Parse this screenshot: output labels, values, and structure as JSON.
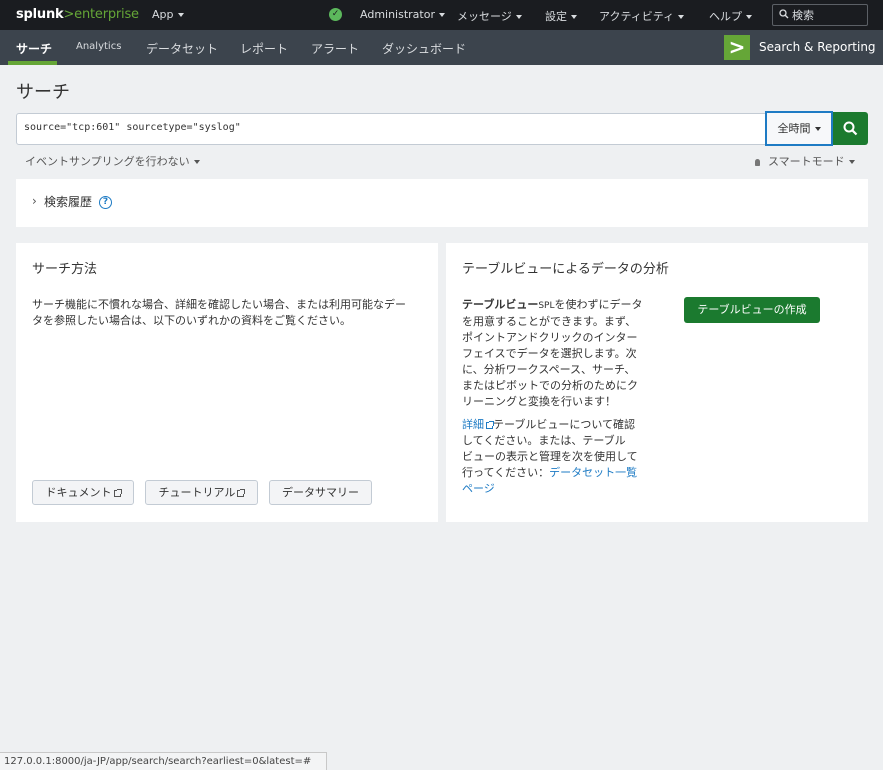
{
  "topbar": {
    "logo_brand": "splunk",
    "logo_arrow": ">",
    "logo_product": "enterprise",
    "app_menu": "App",
    "status_icon": "check-circle-icon",
    "user": "Administrator",
    "messages": "メッセージ",
    "settings": "設定",
    "activity": "アクティビティ",
    "help": "ヘルプ",
    "search_placeholder": "検索"
  },
  "appbar": {
    "nav": [
      "サーチ",
      "Analytics",
      "データセット",
      "レポート",
      "アラート",
      "ダッシュボード"
    ],
    "active_index": 0,
    "app_icon_glyph": ">",
    "app_name": "Search & Reporting"
  },
  "page": {
    "title": "サーチ",
    "query": "source=\"tcp:601\" sourcetype=\"syslog\"",
    "time_range": "全時間",
    "sampling": "イベントサンプリングを行わない",
    "mode": "スマートモード",
    "history_label": "検索履歴",
    "help_glyph": "?"
  },
  "how_to": {
    "title": "サーチ方法",
    "text_line1": "サーチ機能に不慣れな場合、詳細を確認したい場合、または利用可能なデー",
    "text_line2": "タを参照したい場合は、以下のいずれかの資料をご覧ください。",
    "buttons": [
      "ドキュメント",
      "チュートリアル",
      "データサマリー"
    ]
  },
  "table_views": {
    "title": "テーブルビューによるデータの分析",
    "p1_bold": "テーブルビュー",
    "p1_spl": "SPL",
    "p1_line1_rest": "を使わずにデータ",
    "p1_lines": [
      "を用意することができます。まず、",
      "ポイントアンドクリックのインター",
      "フェイスでデータを選択します。次",
      "に、分析ワークスペース、サーチ、",
      "またはピボットでの分析のためにク",
      "リーニングと変換を行います！"
    ],
    "p2_link": "詳細",
    "p2_line1_rest": "テーブルビューについて確認",
    "p2_lines": [
      "してください。または、テーブル",
      "ビューの表示と管理を次を使用して"
    ],
    "p2_line4_prefix": "行ってください：",
    "p2_line4_link": "データセット一覧",
    "p2_line5_link": "ページ",
    "create_button": "テーブルビューの作成"
  },
  "statusbar": {
    "url": "127.0.0.1:8000/ja-JP/app/search/search?earliest=0&latest=#"
  },
  "colors": {
    "accent_green": "#65a637",
    "button_green": "#1b7a2f",
    "link_blue": "#1e7bc4",
    "topbar_bg": "#1a1c20",
    "appbar_bg": "#3c444d"
  }
}
